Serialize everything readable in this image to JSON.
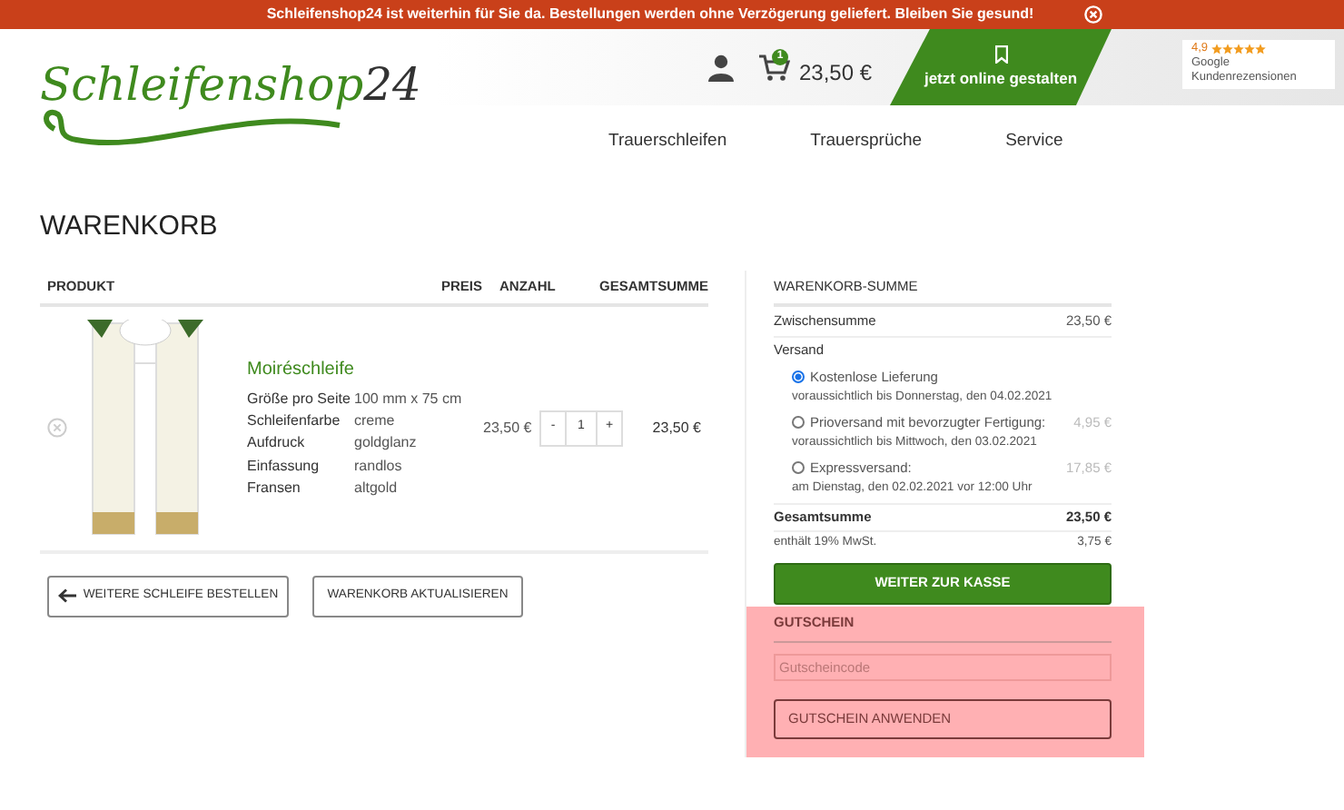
{
  "notice": {
    "text": "Schleifenshop24 ist weiterhin für Sie da. Bestellungen werden ohne Verzögerung geliefert. Bleiben Sie gesund!"
  },
  "header": {
    "logo": "Schleifenshop",
    "logo_number": "24",
    "cart_count": "1",
    "cart_total": "23,50 €",
    "cta": "jetzt online gestalten",
    "rating": "4,9",
    "stars": 5,
    "review_line1": "Google",
    "review_line2": "Kundenrezensionen"
  },
  "nav": [
    "Trauerschleifen",
    "Trauersprüche",
    "Service"
  ],
  "page_title": "WARENKORB",
  "cart": {
    "columns": [
      "PRODUKT",
      "PREIS",
      "ANZAHL",
      "GESAMTSUMME"
    ],
    "items": [
      {
        "name": "Moiréschleife",
        "attributes": [
          {
            "label": "Größe pro Seite",
            "value": "100 mm x 75 cm"
          },
          {
            "label": "Schleifenfarbe",
            "value": "creme"
          },
          {
            "label": "Aufdruck",
            "value": "goldglanz"
          },
          {
            "label": "Einfassung",
            "value": "randlos"
          },
          {
            "label": "Fransen",
            "value": "altgold"
          }
        ],
        "price": "23,50 €",
        "minus": "-",
        "quantity": "1",
        "plus": "+",
        "total": "23,50 €"
      }
    ],
    "buttons": [
      "WEITERE SCHLEIFE BESTELLEN",
      "WARENKORB AKTUALISIEREN"
    ]
  },
  "summary": {
    "title": "WARENKORB-SUMME",
    "subtotal_label": "Zwischensumme",
    "subtotal": "23,50 €",
    "shipping_label": "Versand",
    "shipping_options": [
      {
        "label": "Kostenlose Lieferung",
        "note": "voraussichtlich bis Donnerstag, den 04.02.2021",
        "selected": true
      },
      {
        "label": "Prioversand mit bevorzugter Fertigung:",
        "price": "4,95 €",
        "note": "voraussichtlich bis Mittwoch, den 03.02.2021",
        "selected": false
      },
      {
        "label": "Expressversand:",
        "price": "17,85 €",
        "note": "am Dienstag, den 02.02.2021 vor 12:00 Uhr",
        "selected": false
      }
    ],
    "total_label": "Gesamtsumme",
    "total": "23,50 €",
    "tax_label": "enthält 19% MwSt.",
    "tax": "3,75 €",
    "checkout": "WEITER ZUR KASSE"
  },
  "coupon": {
    "title": "GUTSCHEIN",
    "placeholder": "Gutscheincode",
    "button": "GUTSCHEIN ANWENDEN"
  }
}
